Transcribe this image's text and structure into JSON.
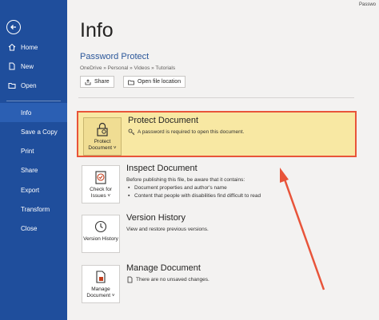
{
  "window": {
    "top_right_text": "Passwo"
  },
  "sidebar": {
    "items": [
      {
        "label": "Home"
      },
      {
        "label": "New"
      },
      {
        "label": "Open"
      },
      {
        "label": "Info"
      },
      {
        "label": "Save a Copy"
      },
      {
        "label": "Print"
      },
      {
        "label": "Share"
      },
      {
        "label": "Export"
      },
      {
        "label": "Transform"
      },
      {
        "label": "Close"
      }
    ]
  },
  "main": {
    "title": "Info",
    "document_name": "Password Protect",
    "document_path": "OneDrive » Personal » Videos » Tutorials",
    "share_label": "Share",
    "open_location_label": "Open file location"
  },
  "sections": {
    "protect": {
      "tile_label": "Protect Document ˅",
      "title": "Protect Document",
      "desc": "A password is required to open this document."
    },
    "inspect": {
      "tile_label": "Check for Issues ˅",
      "title": "Inspect Document",
      "desc": "Before publishing this file, be aware that it contains:",
      "bullets": [
        "Document properties and author's name",
        "Content that people with disabilities find difficult to read"
      ]
    },
    "version": {
      "tile_label": "Version History",
      "title": "Version History",
      "desc": "View and restore previous versions."
    },
    "manage": {
      "tile_label": "Manage Document ˅",
      "title": "Manage Document",
      "desc": "There are no unsaved changes."
    }
  },
  "colors": {
    "sidebar": "#1f4e9c",
    "highlight": "#f8e8a3",
    "annotation": "#e8543a"
  }
}
